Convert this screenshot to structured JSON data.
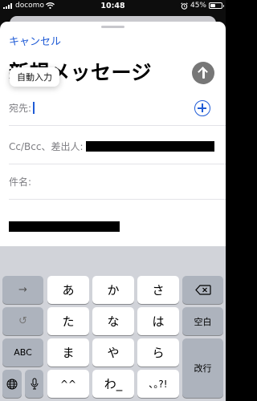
{
  "status": {
    "carrier": "docomo",
    "time": "10:48",
    "battery": "45%",
    "battery_level": 0.45
  },
  "compose": {
    "cancel_label": "キャンセル",
    "title": "新規メッセージ",
    "tooltip": "自動入力",
    "to_label": "宛先:",
    "cc_label": "Cc/Bcc、差出人:",
    "subject_label": "件名:"
  },
  "keyboard": {
    "rows": [
      [
        "→",
        "あ",
        "か",
        "さ",
        "⌫"
      ],
      [
        "↺",
        "た",
        "な",
        "は",
        "空白"
      ],
      [
        "ABC",
        "ま",
        "や",
        "ら",
        "改行"
      ],
      [
        "🌐",
        "🎤",
        "^^",
        "わ_",
        "､｡?!"
      ]
    ],
    "labels": {
      "arrow": "→",
      "a": "あ",
      "ka": "か",
      "sa": "さ",
      "undo": "↺",
      "ta": "た",
      "na": "な",
      "ha": "は",
      "space": "空白",
      "abc": "ABC",
      "ma": "ま",
      "ya": "や",
      "ra": "ら",
      "return": "改行",
      "kaomoji": "^^",
      "wa": "わ_",
      "punct": "､｡?!"
    }
  },
  "icons": {
    "wifi": "wifi-icon",
    "send": "send-arrow-up-icon",
    "add_contact": "plus-circle-icon",
    "delete": "delete-backward-icon",
    "globe": "globe-icon",
    "mic": "microphone-icon"
  },
  "colors": {
    "accent": "#1f5bd6",
    "send_button": "#777777",
    "keyboard_bg": "#d1d3d9",
    "key_dark": "#adb3bd"
  }
}
